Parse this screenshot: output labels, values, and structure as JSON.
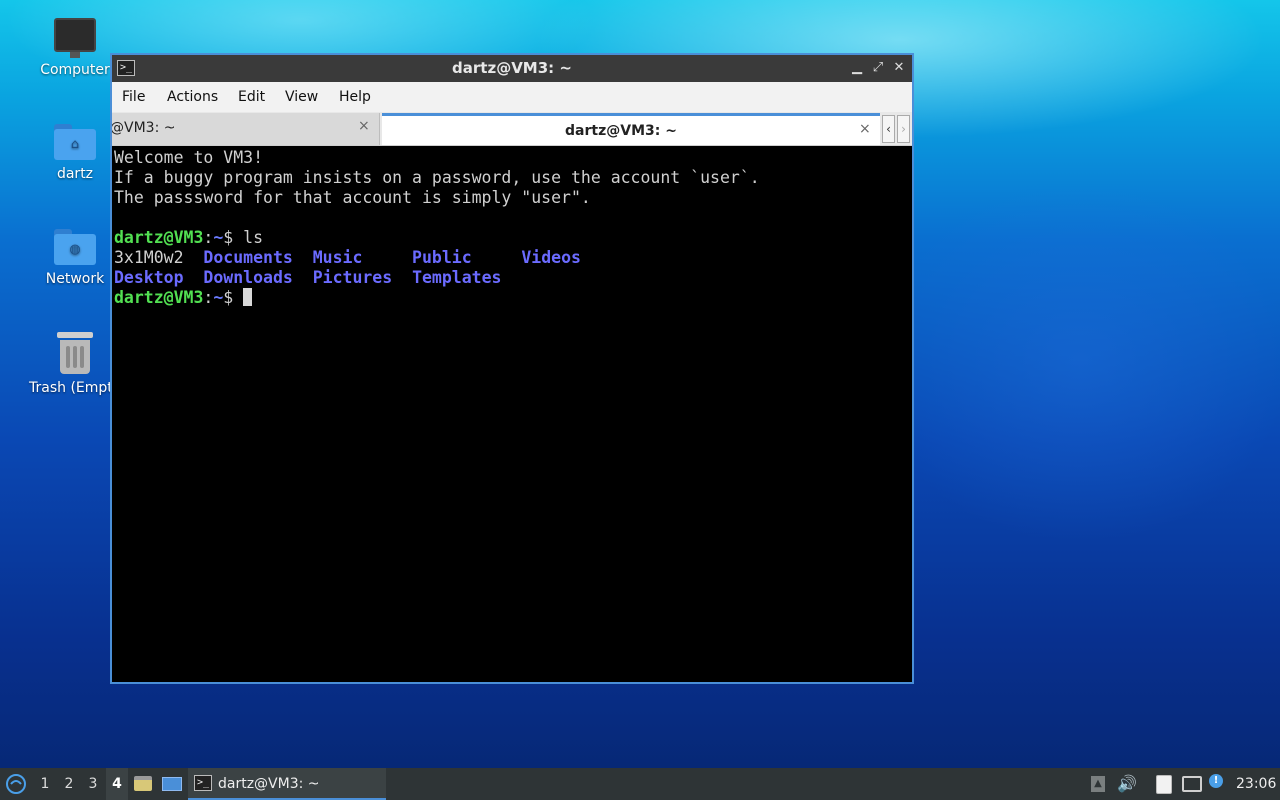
{
  "desktop": {
    "icons": [
      {
        "label": "Computer",
        "icon": "computer-icon"
      },
      {
        "label": "dartz",
        "icon": "home-folder-icon"
      },
      {
        "label": "Network",
        "icon": "network-folder-icon"
      },
      {
        "label": "Trash (Empt",
        "icon": "trash-icon"
      }
    ]
  },
  "window": {
    "title": "dartz@VM3: ~",
    "menu": [
      "File",
      "Actions",
      "Edit",
      "View",
      "Help"
    ],
    "tabs": [
      {
        "label": "@VM3: ~",
        "active": false
      },
      {
        "label": "dartz@VM3: ~",
        "active": true
      }
    ],
    "close_glyph": "×"
  },
  "terminal": {
    "welcome": [
      "Welcome to VM3!",
      "If a buggy program insists on a password, use the account `user`.",
      "The passsword for that account is simply \"user\"."
    ],
    "prompt_user": "dartz@VM3",
    "prompt_colon": ":",
    "prompt_path": "~",
    "prompt_dollar": "$ ",
    "command": "ls",
    "ls_row1": [
      "3x1M0w2",
      "Documents",
      "Music",
      "Public",
      "Videos"
    ],
    "ls_row2": [
      "Desktop",
      "Downloads",
      "Pictures",
      "Templates"
    ]
  },
  "taskbar": {
    "workspaces": [
      "1",
      "2",
      "3",
      "4"
    ],
    "active_workspace": "4",
    "task_label": "dartz@VM3: ~",
    "clock": "23:06"
  },
  "colors": {
    "accent": "#4a8fd8",
    "prompt_green": "#52e052",
    "dir_blue": "#6b6bff"
  }
}
